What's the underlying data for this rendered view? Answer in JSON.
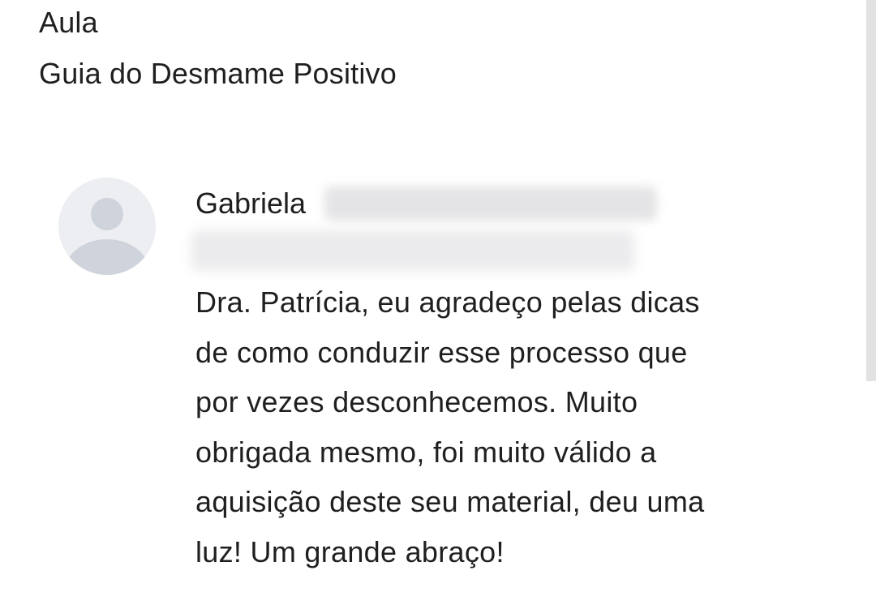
{
  "lesson": {
    "label": "Aula",
    "title": "Guia do Desmame Positivo"
  },
  "comment": {
    "author_first_name": "Gabriela",
    "author_surname_redacted": true,
    "author_email_redacted": true,
    "avatar_icon": "default-user-avatar-icon",
    "text_lines": [
      "Dra. Patrícia, eu agradeço pelas dicas",
      "de como conduzir esse processo que",
      "por vezes desconhecemos. Muito",
      "obrigada mesmo, foi muito válido a",
      "aquisição deste seu material, deu uma",
      "luz! Um grande abraço!"
    ]
  },
  "colors": {
    "background": "#ffffff",
    "text": "#1f1f1f",
    "avatar_bg": "#eceef2",
    "avatar_fg": "#cfd3dc"
  }
}
